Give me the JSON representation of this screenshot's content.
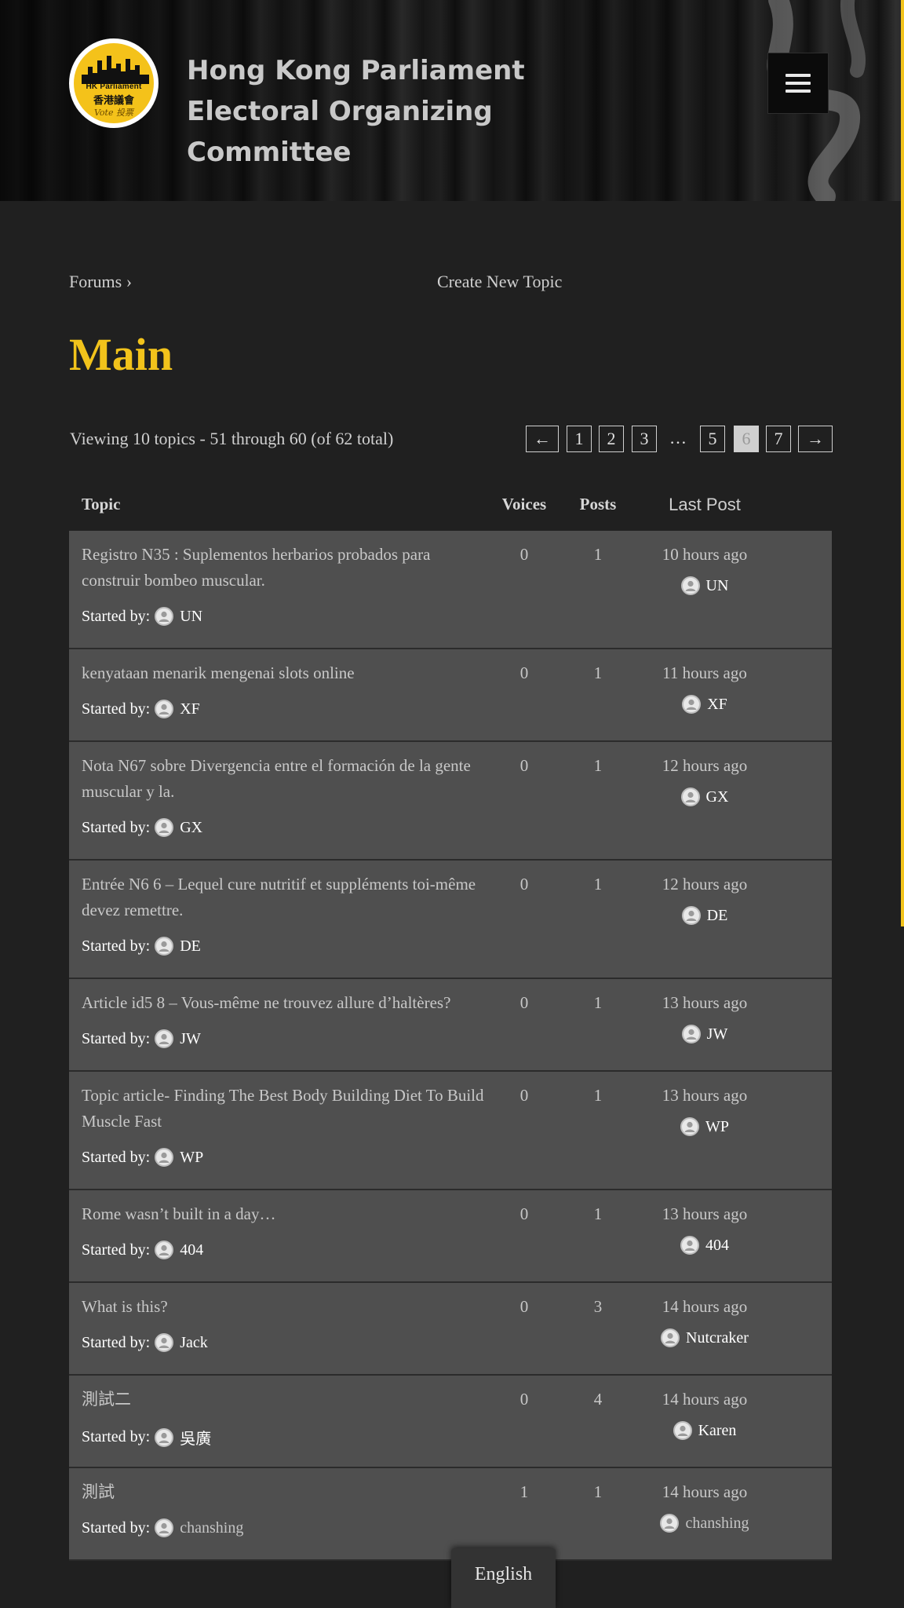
{
  "header": {
    "site_title": "Hong Kong Parliament Electoral Organizing Committee",
    "logo": {
      "line1": "HK Parliament",
      "line2": "香港議會",
      "line3": "Vote 投票"
    },
    "menu_icon": "hamburger-menu-icon"
  },
  "breadcrumb": {
    "root": "Forums",
    "separator": "›"
  },
  "create_topic_label": "Create New Topic",
  "forum_title": "Main",
  "viewing_text": "Viewing 10 topics - 51 through 60 (of 62 total)",
  "pagination": {
    "prev": "←",
    "pages": [
      "1",
      "2",
      "3"
    ],
    "ellipsis": "…",
    "pages_after": [
      "5"
    ],
    "current": "6",
    "pages_end": [
      "7"
    ],
    "next": "→"
  },
  "table": {
    "headers": {
      "topic": "Topic",
      "voices": "Voices",
      "posts": "Posts",
      "last_post": "Last Post"
    },
    "started_by_label": "Started by:",
    "rows": [
      {
        "title": "Registro N35 : Suplementos herbarios probados para construir bombeo muscular.",
        "author": "UN",
        "voices": "0",
        "posts": "1",
        "freshness": "10 hours ago",
        "last_author": "UN"
      },
      {
        "title": "kenyataan menarik mengenai slots online",
        "author": "XF",
        "voices": "0",
        "posts": "1",
        "freshness": "11 hours ago",
        "last_author": "XF"
      },
      {
        "title": "Nota N67 sobre Divergencia entre el formación de la gente muscular y la.",
        "author": "GX",
        "voices": "0",
        "posts": "1",
        "freshness": "12 hours ago",
        "last_author": "GX"
      },
      {
        "title": "Entrée N6 6 – Lequel cure nutritif et suppléments toi-même devez remettre.",
        "author": "DE",
        "voices": "0",
        "posts": "1",
        "freshness": "12 hours ago",
        "last_author": "DE"
      },
      {
        "title": "Article id5 8 – Vous-même ne trouvez allure d’haltères?",
        "author": "JW",
        "voices": "0",
        "posts": "1",
        "freshness": "13 hours ago",
        "last_author": "JW"
      },
      {
        "title": "Topic article- Finding The Best Body Building Diet To Build Muscle Fast",
        "author": "WP",
        "voices": "0",
        "posts": "1",
        "freshness": "13 hours ago",
        "last_author": "WP"
      },
      {
        "title": "Rome wasn’t built in a day…",
        "author": "404",
        "voices": "0",
        "posts": "1",
        "freshness": "13 hours ago",
        "last_author": "404"
      },
      {
        "title": "What is this?",
        "author": "Jack",
        "voices": "0",
        "posts": "3",
        "freshness": "14 hours ago",
        "last_author": "Nutcraker"
      },
      {
        "title": "測試二",
        "author": "吳廣",
        "voices": "0",
        "posts": "4",
        "freshness": "14 hours ago",
        "last_author": "Karen"
      },
      {
        "title": "測試",
        "author": "chanshing",
        "voices": "1",
        "posts": "1",
        "freshness": "14 hours ago",
        "last_author": "chanshing"
      }
    ]
  },
  "language": {
    "label": "English"
  },
  "colors": {
    "accent": "#f2c31b",
    "background": "#202020",
    "row": "#4f4f4f"
  }
}
